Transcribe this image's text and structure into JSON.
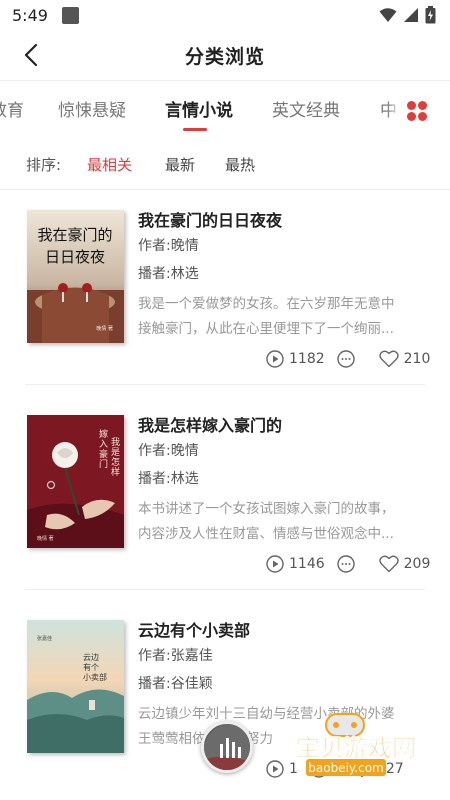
{
  "status_bar": {
    "time": "5:49"
  },
  "header": {
    "title": "分类浏览"
  },
  "tabs": [
    {
      "label": "教育"
    },
    {
      "label": "惊悚悬疑"
    },
    {
      "label": "言情小说"
    },
    {
      "label": "英文经典"
    },
    {
      "label": "中"
    }
  ],
  "sort": {
    "label": "排序:",
    "options": [
      "最相关",
      "最新",
      "最热"
    ],
    "active_color": "#e33a3a"
  },
  "books": [
    {
      "title": "我在豪门的日日夜夜",
      "author_label": "作者:",
      "author": "晚情",
      "narrator_label": "播者:",
      "narrator": "林选",
      "desc_line1": "我是一个爱做梦的女孩。在六岁那年无意中",
      "desc_line2": "接触豪门，从此在心里便埋下了一个绚丽...",
      "plays": "1182",
      "likes": "210",
      "cover_text": "我在豪门的日日夜夜",
      "cover_author": "晚情 著"
    },
    {
      "title": "我是怎样嫁入豪门的",
      "author_label": "作者:",
      "author": "晚情",
      "narrator_label": "播者:",
      "narrator": "林选",
      "desc_line1": "本书讲述了一个女孩试图嫁入豪门的故事，",
      "desc_line2": "内容涉及人性在财富、情感与世俗观念中...",
      "plays": "1146",
      "likes": "209",
      "cover_text": "嫁入豪门 我是怎样",
      "cover_author": "晚情 著"
    },
    {
      "title": "云边有个小卖部",
      "author_label": "作者:",
      "author": "张嘉佳",
      "narrator_label": "播者:",
      "narrator": "谷佳颖",
      "desc_line1": "云边镇少年刘十三自幼与经营小卖部的外婆",
      "desc_line2": "王莺莺相依为命，努力",
      "plays": "1",
      "likes": "227",
      "cover_text": "云边有个小卖部",
      "cover_author": "张嘉佳"
    }
  ],
  "watermark": {
    "text": "宝贝游戏网",
    "url": "baobeiy.com"
  },
  "colors": {
    "accent": "#e33a3a",
    "watermark": "#f2a31b"
  }
}
